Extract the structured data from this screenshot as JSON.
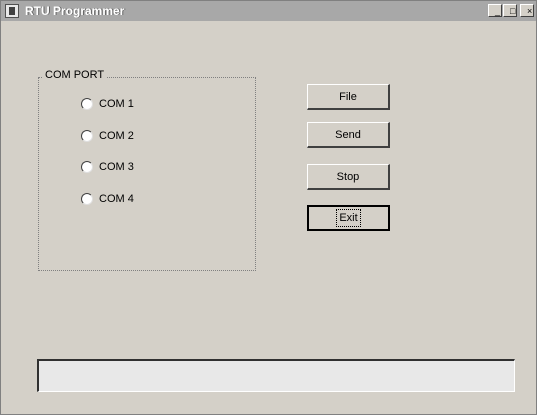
{
  "window": {
    "title": "RTU Programmer",
    "controls": {
      "minimize": "_",
      "maximize": "□",
      "close": "×"
    }
  },
  "com_port": {
    "group_label": "COM PORT",
    "options": [
      "COM 1",
      "COM 2",
      "COM 3",
      "COM 4"
    ],
    "selected": null
  },
  "buttons": {
    "file": "File",
    "send": "Send",
    "stop": "Stop",
    "exit": "Exit"
  },
  "status": {
    "text": ""
  }
}
